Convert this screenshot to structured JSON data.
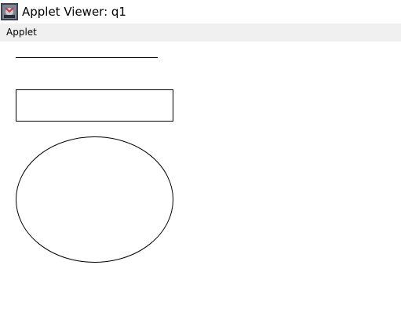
{
  "window": {
    "title": "Applet Viewer: q1",
    "icon": "java-applet-icon"
  },
  "menubar": {
    "items": [
      {
        "label": "Applet"
      }
    ]
  },
  "canvas": {
    "shapes": [
      "line",
      "rectangle",
      "oval"
    ],
    "stroke_color": "#000000",
    "background": "#ffffff"
  }
}
